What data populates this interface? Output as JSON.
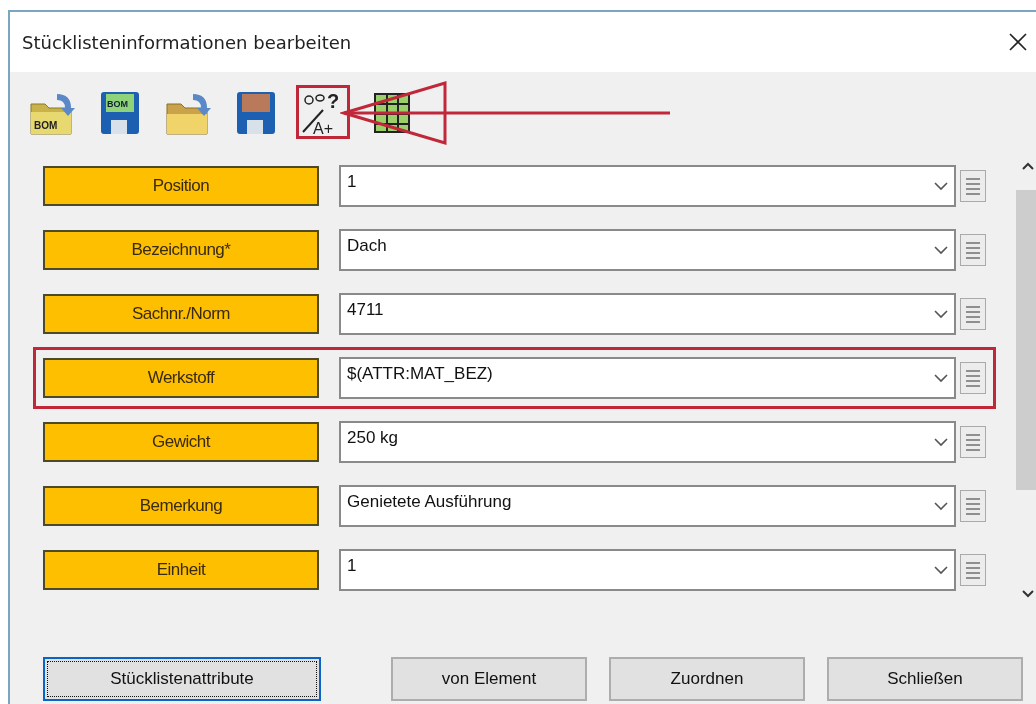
{
  "window": {
    "title": "Stücklisteninformationen bearbeiten"
  },
  "toolbar": [
    {
      "kind": "folder-bom",
      "texts": [
        "BOM"
      ],
      "highlighted": false
    },
    {
      "kind": "floppy-bom",
      "texts": [
        "BOM"
      ],
      "highlighted": false
    },
    {
      "kind": "folder",
      "highlighted": false
    },
    {
      "kind": "floppy",
      "highlighted": false
    },
    {
      "kind": "wand",
      "texts": [
        "?",
        "A+"
      ],
      "highlighted": true
    },
    {
      "kind": "table",
      "highlighted": false
    }
  ],
  "fields": [
    {
      "label": "Position",
      "value": "1",
      "highlighted": false
    },
    {
      "label": "Bezeichnung*",
      "value": "Dach",
      "highlighted": false
    },
    {
      "label": "Sachnr./Norm",
      "value": "4711",
      "highlighted": false
    },
    {
      "label": "Werkstoff",
      "value": "$(ATTR:MAT_BEZ)",
      "highlighted": true
    },
    {
      "label": "Gewicht",
      "value": "250 kg",
      "highlighted": false
    },
    {
      "label": "Bemerkung",
      "value": "Genietete Ausführung",
      "highlighted": false
    },
    {
      "label": "Einheit",
      "value": "1",
      "highlighted": false
    }
  ],
  "buttons": [
    {
      "label": "Stücklistenattribute",
      "focused": true
    },
    {
      "label": "von Element",
      "focused": false
    },
    {
      "label": "Zuordnen",
      "focused": false
    },
    {
      "label": "Schließen",
      "focused": false
    }
  ]
}
